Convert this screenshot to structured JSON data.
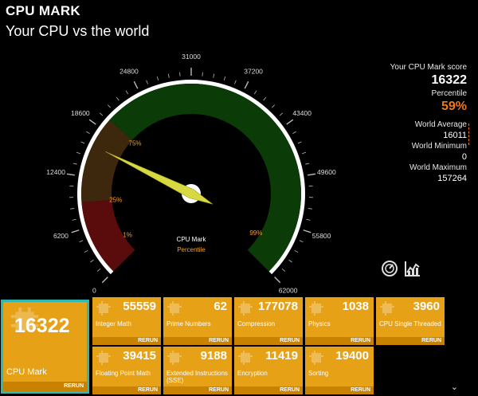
{
  "header": {
    "title": "CPU MARK",
    "subtitle": "Your CPU vs the world"
  },
  "gauge": {
    "ticks": [
      "0",
      "6200",
      "12400",
      "18600",
      "24800",
      "31000",
      "37200",
      "43400",
      "49600",
      "55800",
      "62000"
    ],
    "min": 0,
    "max": 62000,
    "needle_value": 16322,
    "band_labels": [
      {
        "text": "1%",
        "value": 2800
      },
      {
        "text": "25%",
        "value": 9300
      },
      {
        "text": "75%",
        "value": 20000
      },
      {
        "text": "99%",
        "value": 58800
      }
    ],
    "bands": [
      {
        "from": 0,
        "to": 9300,
        "color": "#5a0c0c"
      },
      {
        "from": 9300,
        "to": 20000,
        "color": "#3d280e"
      },
      {
        "from": 20000,
        "to": 62000,
        "color": "#0b3c08"
      }
    ],
    "legend_label": "CPU Mark",
    "legend_sub": "Percentile",
    "colors": {
      "needle": "#d8d840",
      "band_text": "#f0a030",
      "rim": "#ffffff"
    }
  },
  "stats": {
    "your_score_label": "Your CPU Mark score",
    "your_score": "16322",
    "percentile_label": "Percentile",
    "percentile": "59%",
    "world_avg_label": "World Average",
    "world_avg": "16011",
    "world_min_label": "World Minimum",
    "world_min": "0",
    "world_max_label": "World Maximum",
    "world_max": "157264"
  },
  "icons": {
    "gauge_button": "speedometer-icon",
    "chart_button": "chart-icon"
  },
  "main_tile": {
    "value": "16322",
    "label": "CPU Mark",
    "rerun": "RERUN"
  },
  "tiles": [
    {
      "value": "55559",
      "label": "Integer Math",
      "rerun": "RERUN"
    },
    {
      "value": "62",
      "label": "Prime Numbers",
      "rerun": "RERUN"
    },
    {
      "value": "177078",
      "label": "Compression",
      "rerun": "RERUN"
    },
    {
      "value": "1038",
      "label": "Physics",
      "rerun": "RERUN"
    },
    {
      "value": "3960",
      "label": "CPU Single Threaded",
      "rerun": "RERUN"
    },
    {
      "value": "39415",
      "label": "Floating Point Math",
      "rerun": "RERUN"
    },
    {
      "value": "9188",
      "label": "Extended Instructions (SSE)",
      "rerun": "RERUN"
    },
    {
      "value": "11419",
      "label": "Encryption",
      "rerun": "RERUN"
    },
    {
      "value": "19400",
      "label": "Sorting",
      "rerun": "RERUN"
    }
  ],
  "footer": {
    "chevron": "⌄"
  }
}
